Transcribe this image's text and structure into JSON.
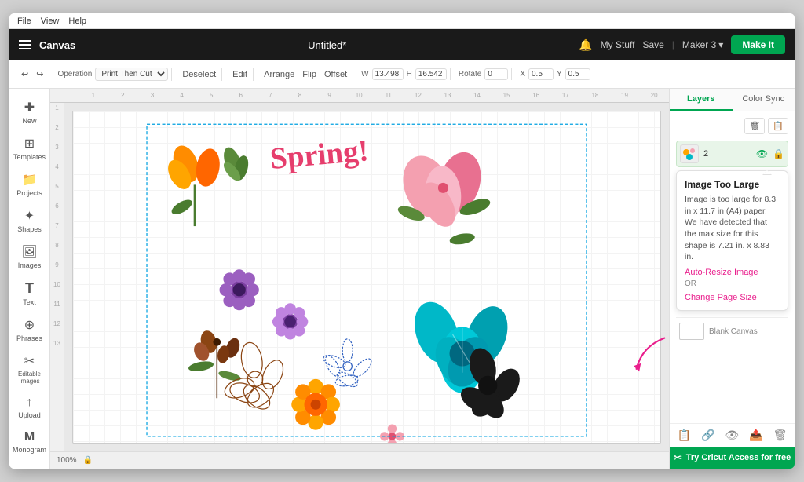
{
  "app": {
    "title": "Untitled*",
    "menu": [
      "File",
      "View",
      "Help"
    ]
  },
  "topnav": {
    "logo": "Canvas",
    "title": "Untitled*",
    "bell_label": "🔔",
    "mystuff": "My Stuff",
    "save": "Save",
    "separator": "|",
    "maker": "Maker 3",
    "make_btn": "Make It"
  },
  "toolbar": {
    "undo": "↩",
    "redo": "↪",
    "operation_label": "Operation",
    "operation_value": "Print Then Cut",
    "deselect": "Deselect",
    "edit": "Edit",
    "arrange": "Arrange",
    "flip": "Flip",
    "offset": "Offset",
    "size_w_label": "W",
    "size_w_value": "13.498",
    "size_h_label": "H",
    "size_h_value": "16.542",
    "rotate_label": "Rotate",
    "rotate_value": "0",
    "position_x_label": "X",
    "position_x_value": "0.5",
    "position_y_label": "Y",
    "position_y_value": "0.5"
  },
  "sidebar": {
    "items": [
      {
        "icon": "✚",
        "label": "New"
      },
      {
        "icon": "⊞",
        "label": "Templates"
      },
      {
        "icon": "📁",
        "label": "Projects"
      },
      {
        "icon": "✦",
        "label": "Shapes"
      },
      {
        "icon": "🖼",
        "label": "Images"
      },
      {
        "icon": "T",
        "label": "Text"
      },
      {
        "icon": "⊕",
        "label": "Phrases"
      },
      {
        "icon": "✂",
        "label": "Editable Images"
      },
      {
        "icon": "↑",
        "label": "Upload"
      },
      {
        "icon": "M",
        "label": "Monogram"
      }
    ]
  },
  "ruler": {
    "marks": [
      "1",
      "2",
      "3",
      "4",
      "5",
      "6",
      "7",
      "8",
      "9",
      "10",
      "11",
      "12",
      "13",
      "14",
      "15",
      "16",
      "17",
      "18",
      "19",
      "20"
    ]
  },
  "status": {
    "zoom": "100%",
    "lock_icon": "🔒"
  },
  "right_panel": {
    "tabs": [
      "Layers",
      "Color Sync"
    ],
    "active_tab": "Layers",
    "toolbar_icons": [
      "🗑",
      "📋"
    ],
    "layer": {
      "number": "2",
      "eye_icon": "👁",
      "lock_icon": "🔒"
    },
    "tooltip": {
      "title": "Image Too Large",
      "body": "Image is too large for 8.3 in x 11.7 in (A4) paper. We have detected that the max size for this shape is 7.21 in. x 8.83 in.",
      "link1": "Auto-Resize Image",
      "or": "OR",
      "link2": "Change Page Size"
    },
    "blank_canvas": "Blank Canvas",
    "bottom_icons": [
      "📋",
      "🔗",
      "👁",
      "📤",
      "🗑"
    ],
    "try_cricut": "Try Cricut Access for free"
  }
}
